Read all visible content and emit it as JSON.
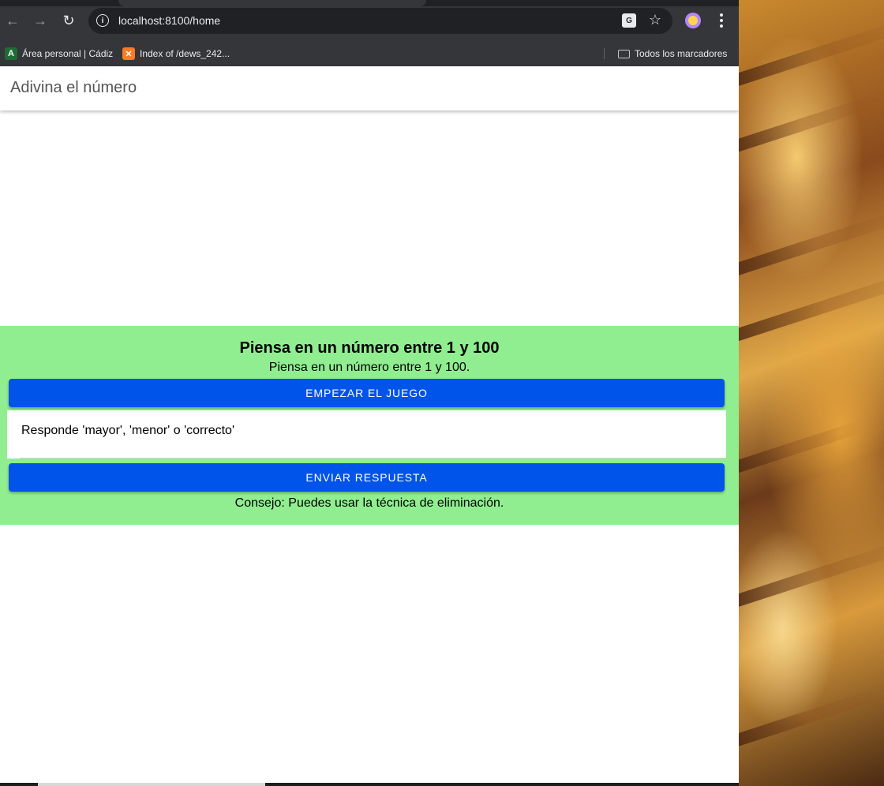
{
  "browser": {
    "url": "localhost:8100/home",
    "bookmarks": [
      {
        "label": "Área personal | Cádiz",
        "icon": "moodle-icon"
      },
      {
        "label": "Index of /dews_242...",
        "icon": "xampp-icon"
      }
    ],
    "all_bookmarks_label": "Todos los marcadores"
  },
  "app": {
    "header_title": "Adivina el número",
    "game": {
      "title": "Piensa en un número entre 1 y 100",
      "subtitle": "Piensa en un número entre 1 y 100.",
      "start_button": "EMPEZAR EL JUEGO",
      "answer_placeholder": "Responde 'mayor', 'menor' o 'correcto'",
      "send_button": "ENVIAR RESPUESTA",
      "hint": "Consejo: Puedes usar la técnica de eliminación."
    }
  },
  "colors": {
    "card_background": "#90ee90",
    "primary_button": "#0054e9",
    "browser_chrome": "#35363a"
  }
}
